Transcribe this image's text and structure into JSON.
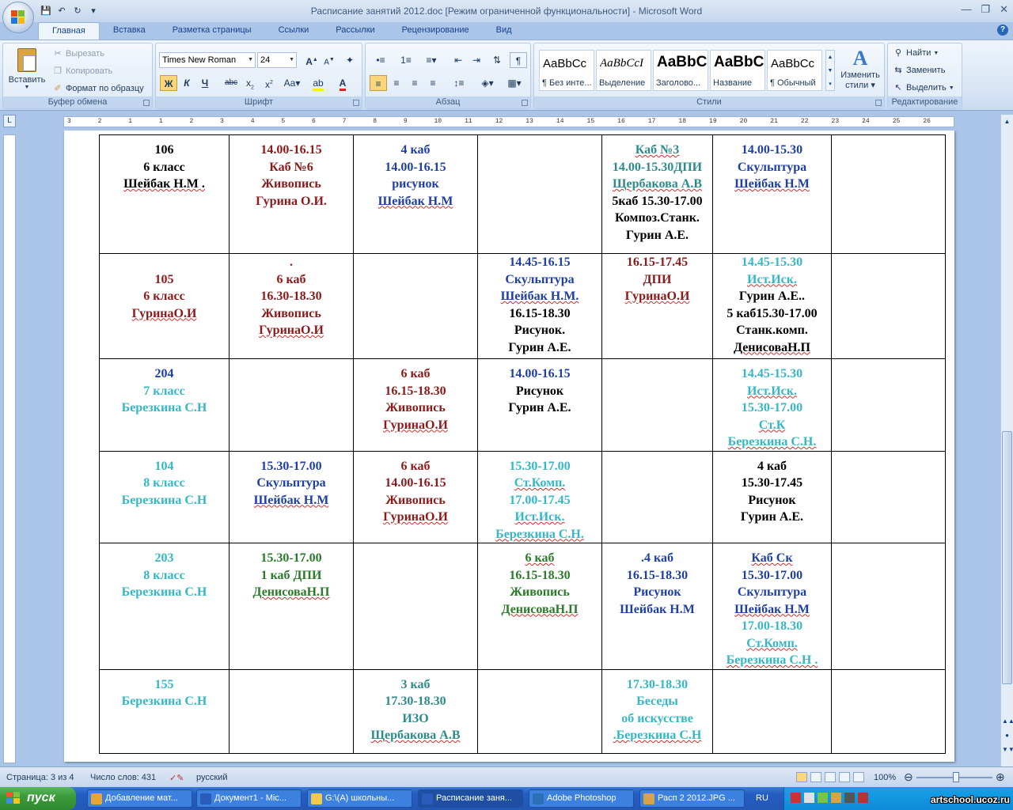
{
  "window": {
    "title": "Расписание занятий 2012.doc [Режим ограниченной функциональности] - Microsoft Word"
  },
  "ribbon": {
    "tabs": [
      "Главная",
      "Вставка",
      "Разметка страницы",
      "Ссылки",
      "Рассылки",
      "Рецензирование",
      "Вид"
    ],
    "clipboard": {
      "paste": "Вставить",
      "cut": "Вырезать",
      "copy": "Копировать",
      "format_painter": "Формат по образцу",
      "label": "Буфер обмена"
    },
    "font": {
      "family": "Times New Roman",
      "size": "24",
      "label": "Шрифт"
    },
    "paragraph": {
      "label": "Абзац"
    },
    "styles": {
      "items": [
        {
          "sample": "AaBbCc",
          "name": "¶ Без инте..."
        },
        {
          "sample": "AaBbCcI",
          "name": "Выделение"
        },
        {
          "sample": "AaBbC",
          "name": "Заголово..."
        },
        {
          "sample": "AaBbC",
          "name": "Название"
        },
        {
          "sample": "AaBbCc",
          "name": "¶ Обычный"
        }
      ],
      "change_line1": "Изменить",
      "change_line2": "стили",
      "label": "Стили"
    },
    "editing": {
      "find": "Найти",
      "replace": "Заменить",
      "select": "Выделить",
      "label": "Редактирование"
    }
  },
  "ruler": {
    "ticks": [
      "3",
      "2",
      "1",
      "1",
      "2",
      "3",
      "4",
      "5",
      "6",
      "7",
      "8",
      "9",
      "10",
      "11",
      "12",
      "13",
      "14",
      "15",
      "16",
      "17",
      "18",
      "19",
      "20",
      "21",
      "22",
      "23",
      "24",
      "25",
      "26"
    ]
  },
  "schedule": {
    "rows": [
      {
        "cells": [
          [
            {
              "t": "106",
              "c": "black"
            },
            {
              "t": "6 класс",
              "c": "black"
            },
            {
              "t": "Шейбак Н.М .",
              "c": "black",
              "w": true
            }
          ],
          [
            {
              "t": "14.00-16.15",
              "c": "red"
            },
            {
              "t": "Каб №6",
              "c": "red"
            },
            {
              "t": "Живопись",
              "c": "red"
            },
            {
              "t": "Гурина О.И.",
              "c": "red"
            }
          ],
          [
            {
              "t": "4 каб",
              "c": "blue"
            },
            {
              "t": "14.00-16.15",
              "c": "blue"
            },
            {
              "t": "рисунок",
              "c": "blue"
            },
            {
              "t": "Шейбак Н.М",
              "c": "blue",
              "w": true
            }
          ],
          [],
          [
            {
              "t": "Каб №3",
              "c": "teal",
              "w": true
            },
            {
              "t": "14.00-15.30ДПИ",
              "c": "teal"
            },
            {
              "t": "Щербакова А.В",
              "c": "teal",
              "w": true
            },
            {
              "t": "5каб 15.30-17.00",
              "c": "black"
            },
            {
              "t": "Композ.Станк.",
              "c": "black"
            },
            {
              "t": "Гурин А.Е.",
              "c": "black"
            }
          ],
          [
            {
              "t": "14.00-15.30",
              "c": "blue"
            },
            {
              "t": "Скульптура",
              "c": "blue"
            },
            {
              "t": "Шейбак Н.М",
              "c": "blue",
              "w": true
            }
          ],
          []
        ]
      },
      {
        "cells": [
          [
            {
              "t": "",
              "c": "black"
            },
            {
              "t": "105",
              "c": "red"
            },
            {
              "t": "6 класс",
              "c": "red"
            },
            {
              "t": "ГуринаО.И",
              "c": "red",
              "w": true
            }
          ],
          [
            {
              "t": ".",
              "c": "red"
            },
            {
              "t": "6 каб",
              "c": "red"
            },
            {
              "t": "16.30-18.30",
              "c": "red"
            },
            {
              "t": "Живопись",
              "c": "red"
            },
            {
              "t": "ГуринаО.И",
              "c": "red",
              "w": true
            }
          ],
          [],
          [
            {
              "t": "14.45-16.15",
              "c": "blue"
            },
            {
              "t": "Скульптура",
              "c": "blue"
            },
            {
              "t": "Шейбак Н.М.",
              "c": "blue",
              "w": true
            },
            {
              "t": "16.15-18.30",
              "c": "black"
            },
            {
              "t": "Рисунок.",
              "c": "black"
            },
            {
              "t": "Гурин А.Е.",
              "c": "black"
            }
          ],
          [
            {
              "t": "16.15-17.45",
              "c": "red"
            },
            {
              "t": "ДПИ",
              "c": "red"
            },
            {
              "t": "ГуринаО.И",
              "c": "red",
              "w": true
            }
          ],
          [
            {
              "t": "14.45-15.30",
              "c": "cyan"
            },
            {
              "t": "Ист.Иск.",
              "c": "cyan",
              "w": true
            },
            {
              "t": "Гурин А.Е..",
              "c": "black"
            },
            {
              "t": "5 каб15.30-17.00",
              "c": "black"
            },
            {
              "t": "Станк.комп.",
              "c": "black"
            },
            {
              "t": "ДенисоваН.П",
              "c": "black",
              "w": true
            }
          ],
          []
        ]
      },
      {
        "cells": [
          [
            {
              "t": "204",
              "c": "blue"
            },
            {
              "t": "7 класс",
              "c": "cyan"
            },
            {
              "t": "Березкина С.Н",
              "c": "cyan"
            }
          ],
          [],
          [
            {
              "t": "6 каб",
              "c": "red"
            },
            {
              "t": "16.15-18.30",
              "c": "red"
            },
            {
              "t": "Живопись",
              "c": "red"
            },
            {
              "t": "ГуринаО.И",
              "c": "red",
              "w": true
            }
          ],
          [
            {
              "t": "14.00-16.15",
              "c": "blue"
            },
            {
              "t": "Рисунок",
              "c": "black"
            },
            {
              "t": "Гурин А.Е.",
              "c": "black"
            }
          ],
          [],
          [
            {
              "t": "14.45-15.30",
              "c": "cyan"
            },
            {
              "t": "Ист.Иск.",
              "c": "cyan",
              "w": true
            },
            {
              "t": "15.30-17.00",
              "c": "cyan"
            },
            {
              "t": "Ст.К",
              "c": "cyan",
              "w": true
            },
            {
              "t": "Березкина С.Н.",
              "c": "cyan",
              "w": true
            }
          ],
          []
        ]
      },
      {
        "cells": [
          [
            {
              "t": "104",
              "c": "cyan"
            },
            {
              "t": "8 класс",
              "c": "cyan"
            },
            {
              "t": "Березкина С.Н",
              "c": "cyan"
            }
          ],
          [
            {
              "t": "15.30-17.00",
              "c": "blue"
            },
            {
              "t": "Скульптура",
              "c": "blue"
            },
            {
              "t": "Шейбак Н.М",
              "c": "blue",
              "w": true
            }
          ],
          [
            {
              "t": "6 каб",
              "c": "red"
            },
            {
              "t": "14.00-16.15",
              "c": "red"
            },
            {
              "t": "Живопись",
              "c": "red"
            },
            {
              "t": "ГуринаО.И",
              "c": "red",
              "w": true
            }
          ],
          [
            {
              "t": "15.30-17.00",
              "c": "cyan"
            },
            {
              "t": "Ст.Комп.",
              "c": "cyan",
              "w": true
            },
            {
              "t": "17.00-17.45",
              "c": "cyan"
            },
            {
              "t": "Ист.Иск.",
              "c": "cyan",
              "w": true
            },
            {
              "t": "Березкина С.Н.",
              "c": "cyan",
              "w": true
            }
          ],
          [],
          [
            {
              "t": "4 каб",
              "c": "black"
            },
            {
              "t": "15.30-17.45",
              "c": "black"
            },
            {
              "t": "Рисунок",
              "c": "black"
            },
            {
              "t": "Гурин А.Е.",
              "c": "black"
            }
          ],
          []
        ]
      },
      {
        "cells": [
          [
            {
              "t": "203",
              "c": "cyan"
            },
            {
              "t": "8 класс",
              "c": "cyan"
            },
            {
              "t": "Березкина С.Н",
              "c": "cyan"
            }
          ],
          [
            {
              "t": "15.30-17.00",
              "c": "green"
            },
            {
              "t": "1 каб ДПИ",
              "c": "green"
            },
            {
              "t": "ДенисоваН.П",
              "c": "green",
              "w": true
            }
          ],
          [],
          [
            {
              "t": "6 каб",
              "c": "green",
              "w": true
            },
            {
              "t": "16.15-18.30",
              "c": "green"
            },
            {
              "t": "Живопись",
              "c": "green"
            },
            {
              "t": "ДенисоваН.П",
              "c": "green",
              "w": true
            }
          ],
          [
            {
              "t": ".4 каб",
              "c": "blue"
            },
            {
              "t": "16.15-18.30",
              "c": "blue"
            },
            {
              "t": "Рисунок",
              "c": "blue"
            },
            {
              "t": "Шейбак Н.М",
              "c": "blue"
            }
          ],
          [
            {
              "t": "Каб Ск",
              "c": "blue",
              "w": true
            },
            {
              "t": "15.30-17.00",
              "c": "blue"
            },
            {
              "t": "Скульптура",
              "c": "blue"
            },
            {
              "t": "Шейбак Н.М",
              "c": "blue",
              "w": true
            },
            {
              "t": "17.00-18.30",
              "c": "cyan"
            },
            {
              "t": "Ст.Комп.",
              "c": "cyan",
              "w": true
            },
            {
              "t": "Березкина С.Н .",
              "c": "cyan",
              "w": true
            }
          ],
          []
        ]
      },
      {
        "cells": [
          [
            {
              "t": "155",
              "c": "cyan"
            },
            {
              "t": "Березкина С.Н",
              "c": "cyan"
            }
          ],
          [],
          [
            {
              "t": "3 каб",
              "c": "teal"
            },
            {
              "t": "17.30-18.30",
              "c": "teal"
            },
            {
              "t": "ИЗО",
              "c": "teal"
            },
            {
              "t": "Щербакова А.В",
              "c": "teal",
              "w": true
            }
          ],
          [],
          [
            {
              "t": "17.30-18.30",
              "c": "cyan"
            },
            {
              "t": "Беседы",
              "c": "cyan"
            },
            {
              "t": "об искусстве",
              "c": "cyan"
            },
            {
              "t": ".Березкина С.Н",
              "c": "cyan",
              "w": true
            }
          ],
          [],
          []
        ]
      }
    ]
  },
  "statusbar": {
    "page": "Страница: 3 из 4",
    "words": "Число слов: 431",
    "language": "русский",
    "zoom": "100%"
  },
  "taskbar": {
    "start": "пуск",
    "tasks": [
      {
        "label": "Добавление мат...",
        "color": "#e8a531"
      },
      {
        "label": "Документ1 - Mic...",
        "color": "#2a5bb8"
      },
      {
        "label": "G:\\(А) школьны...",
        "color": "#f2c94c"
      },
      {
        "label": "Расписание заня...",
        "color": "#2a5bb8"
      },
      {
        "label": "Adobe Photoshop",
        "color": "#2b6fb5"
      },
      {
        "label": "Расп 2 2012.JPG ...",
        "color": "#d9a441"
      }
    ],
    "lang": "RU",
    "watermark": "artschool.ucoz.ru"
  }
}
